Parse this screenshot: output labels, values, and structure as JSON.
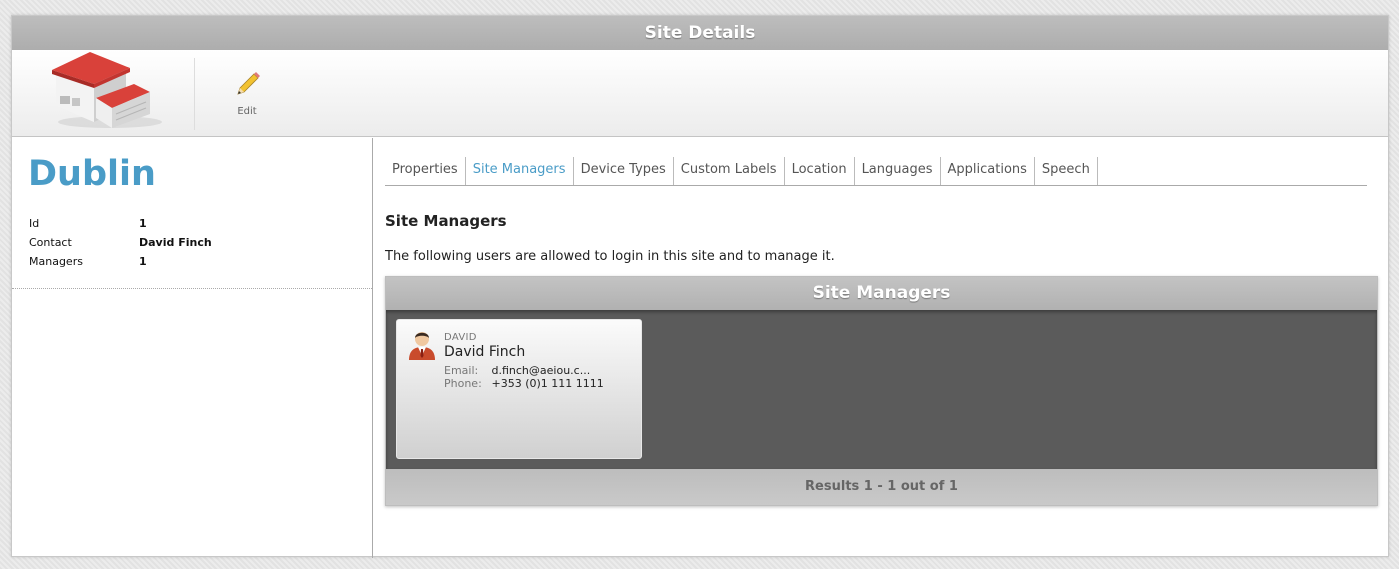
{
  "window": {
    "title": "Site Details"
  },
  "toolbar": {
    "edit_label": "Edit"
  },
  "site": {
    "name": "Dublin",
    "properties": [
      {
        "key": "Id",
        "value": "1"
      },
      {
        "key": "Contact",
        "value": "David Finch"
      },
      {
        "key": "Managers",
        "value": "1"
      }
    ]
  },
  "tabs": [
    {
      "label": "Properties"
    },
    {
      "label": "Site Managers"
    },
    {
      "label": "Device Types"
    },
    {
      "label": "Custom Labels"
    },
    {
      "label": "Location"
    },
    {
      "label": "Languages"
    },
    {
      "label": "Applications"
    },
    {
      "label": "Speech"
    }
  ],
  "active_tab": "Site Managers",
  "section": {
    "title": "Site Managers",
    "description": "The following users are allowed to login in this site and to manage it."
  },
  "managers_panel": {
    "header": "Site Managers",
    "footer": "Results 1 - 1 out of 1",
    "users": [
      {
        "login": "DAVID",
        "name": "David Finch",
        "email_label": "Email:",
        "email": "d.finch@aeiou.c...",
        "phone_label": "Phone:",
        "phone": "+353 (0)1 111 1111"
      }
    ]
  },
  "colors": {
    "accent": "#4a9cc7",
    "panel_dark": "#5b5b5b",
    "header_gray": "#b5b5b5"
  },
  "icons": {
    "site": "building-icon",
    "edit": "pencil-icon",
    "user": "user-avatar-icon"
  }
}
